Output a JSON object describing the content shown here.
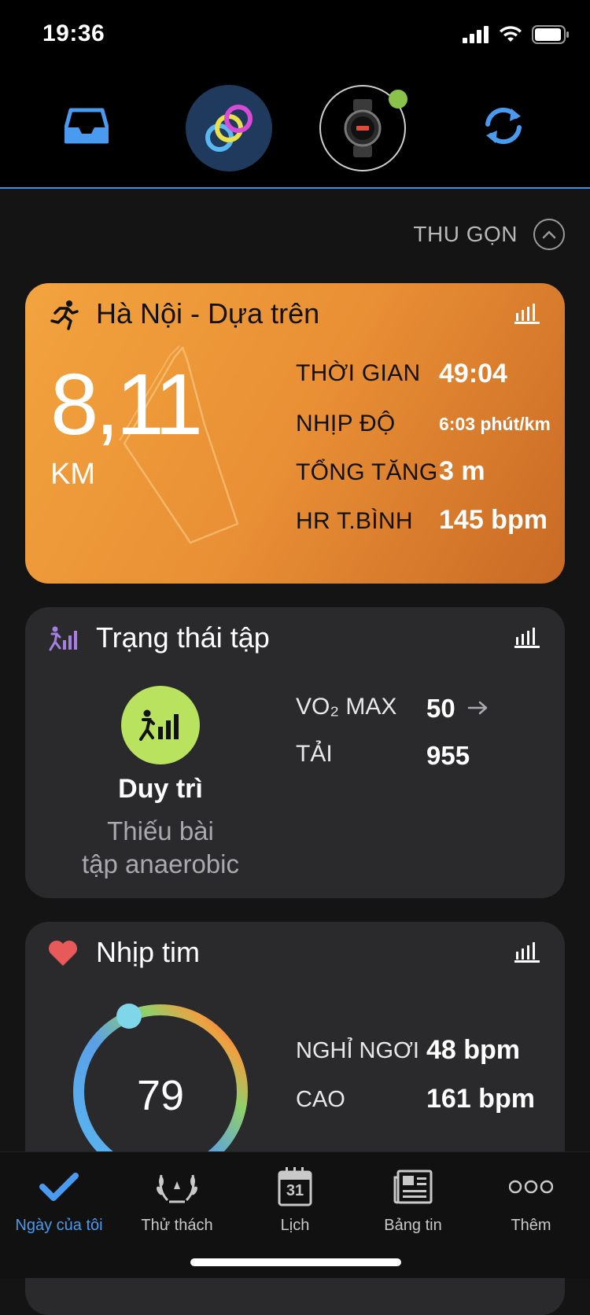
{
  "status_bar": {
    "time": "19:36"
  },
  "top_nav": {
    "inbox_icon": "inbox-tray-icon",
    "connect_icon": "garmin-connect-rings-icon",
    "device_icon": "watch-device-icon",
    "sync_icon": "sync-icon",
    "device_connected_color": "#8bc34a"
  },
  "collapse": {
    "label": "THU GỌN"
  },
  "activity_card": {
    "title": "Hà Nội - Dựa trên",
    "distance": "8,11",
    "unit": "KM",
    "stats": [
      {
        "label": "THỜI GIAN",
        "value": "49:04"
      },
      {
        "label": "NHỊP ĐỘ",
        "value": "6:03 phút/km"
      },
      {
        "label": "TỔNG TĂNG",
        "value": "3 m"
      },
      {
        "label": "HR T.BÌNH",
        "value": "145 bpm"
      }
    ],
    "accent": "#ec9a3a"
  },
  "training_card": {
    "title": "Trạng thái tập",
    "status": "Duy trì",
    "description_line1": "Thiếu bài",
    "description_line2": "tập anaerobic",
    "vo2_label": "VO₂ MAX",
    "vo2_value": "50",
    "load_label": "TẢI",
    "load_value": "955",
    "status_color": "#b9e35e"
  },
  "heart_card": {
    "title": "Nhịp tim",
    "current": "79",
    "resting_label": "NGHỈ NGƠI",
    "resting_value": "48 bpm",
    "high_label": "CAO",
    "high_value": "161 bpm"
  },
  "bottom_nav": [
    {
      "label": "Ngày của tôi",
      "icon": "checkmark-icon",
      "active": true
    },
    {
      "label": "Thử thách",
      "icon": "laurel-wreath-icon"
    },
    {
      "label": "Lịch",
      "icon": "calendar-icon",
      "calendar_day": "31"
    },
    {
      "label": "Bảng tin",
      "icon": "newsfeed-icon"
    },
    {
      "label": "Thêm",
      "icon": "more-dots-icon"
    }
  ],
  "active_color": "#4a9bf0"
}
